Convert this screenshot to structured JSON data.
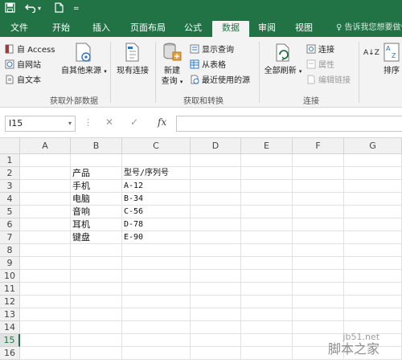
{
  "qat": {
    "save": "save-icon",
    "undo": "undo-icon",
    "new": "new-file-icon",
    "more": "customize-icon"
  },
  "tabs": [
    {
      "label": "文件"
    },
    {
      "label": "开始"
    },
    {
      "label": "插入"
    },
    {
      "label": "页面布局"
    },
    {
      "label": "公式"
    },
    {
      "label": "数据",
      "active": true
    },
    {
      "label": "审阅"
    },
    {
      "label": "视图"
    }
  ],
  "tellme": "♀ 告诉我您想要做什",
  "ribbon": {
    "get_external": {
      "access": "自 Access",
      "web": "自网站",
      "text": "自文本",
      "other": "自其他来源",
      "existing": "现有连接",
      "group": "获取外部数据"
    },
    "get_transform": {
      "new_query": "新建",
      "new_query2": "查询",
      "show_queries": "显示查询",
      "from_table": "从表格",
      "recent": "最近使用的源",
      "group": "获取和转换"
    },
    "connections": {
      "refresh": "全部刷新",
      "connect": "连接",
      "props": "属性",
      "edit_links": "编辑链接",
      "group": "连接"
    },
    "sort": {
      "az": "A↓Z",
      "sort": "排序"
    }
  },
  "formula": {
    "namebox": "I15",
    "cancel": "✕",
    "enter": "✓",
    "fx": "fx",
    "value": ""
  },
  "columns": [
    "A",
    "B",
    "C",
    "D",
    "E",
    "F",
    "G"
  ],
  "rows": [
    "1",
    "2",
    "3",
    "4",
    "5",
    "6",
    "7",
    "8",
    "9",
    "10",
    "11",
    "12",
    "13",
    "14",
    "15",
    "16"
  ],
  "cells": {
    "B2": "产品",
    "C2": "型号/序列号",
    "B3": "手机",
    "C3": "A-12",
    "B4": "电脑",
    "C4": "B-34",
    "B5": "音响",
    "C5": "C-56",
    "B6": "耳机",
    "C6": "D-78",
    "B7": "键盘",
    "C7": "E-90"
  },
  "selected_cell": "I15",
  "watermark": {
    "line1": "jb51.net",
    "line2": "脚本之家"
  },
  "colors": {
    "brand": "#217346",
    "ribbon_bg": "#f3f3f3"
  }
}
